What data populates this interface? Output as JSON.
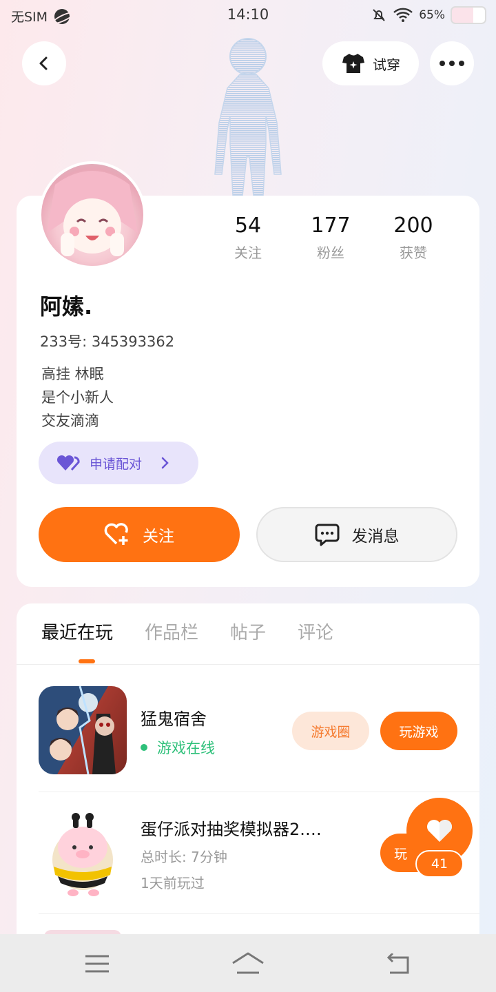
{
  "status_bar": {
    "carrier": "无SIM",
    "time": "14:10",
    "battery": "65%"
  },
  "header": {
    "tryon_label": "试穿"
  },
  "profile": {
    "username": "阿嫊.",
    "uid": "233号: 345393362",
    "bio": [
      "高挂 林眠",
      "是个小新人",
      "交友滴滴"
    ],
    "stats": [
      {
        "value": "54",
        "label": "关注"
      },
      {
        "value": "177",
        "label": "粉丝"
      },
      {
        "value": "200",
        "label": "获赞"
      }
    ],
    "pair_label": "申请配对",
    "follow_label": "关注",
    "message_label": "发消息"
  },
  "tabs": [
    "最近在玩",
    "作品栏",
    "帖子",
    "评论"
  ],
  "games": [
    {
      "name": "猛鬼宿舍",
      "status": "游戏在线",
      "circle_label": "游戏圈",
      "play_label": "玩游戏"
    },
    {
      "name": "蛋仔派对抽奖模拟器2.…",
      "duration": "总时长: 7分钟",
      "last_played": "1天前玩过",
      "play_label": "玩"
    }
  ],
  "like_count": "41",
  "colors": {
    "accent": "#ff7212",
    "pair_bg": "#e8e4fb",
    "pair_text": "#6a55d6",
    "online": "#2ec07a"
  }
}
